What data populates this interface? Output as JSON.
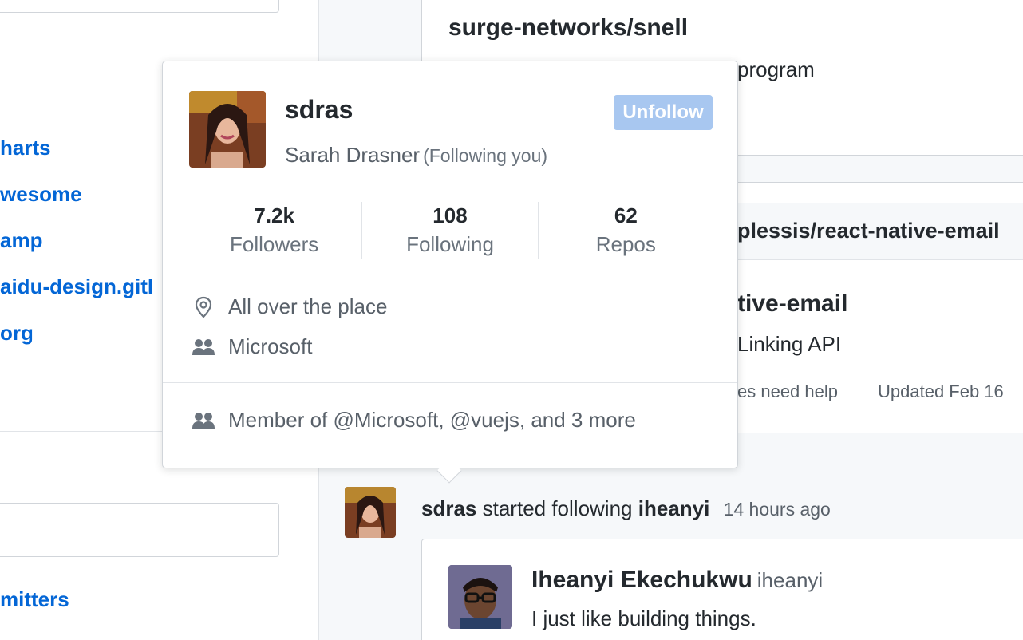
{
  "sidebar": {
    "repos": [
      "harts",
      "wesome",
      "amp",
      "aidu-design.gitl",
      "org"
    ],
    "bottom_link": "mitters"
  },
  "feed": {
    "card1": {
      "title": "surge-networks/snell",
      "desc_fragment": "program"
    },
    "card2": {
      "band_title": "plessis/react-native-email",
      "title_fragment": "tive-email",
      "desc_fragment": "Linking API",
      "meta_issues": "es need help",
      "meta_updated": "Updated Feb 16"
    },
    "event": {
      "actor": "sdras",
      "verb": "started following",
      "target": "iheanyi",
      "time": "14 hours ago"
    },
    "followed_user": {
      "name": "Iheanyi Ekechukwu",
      "login": "iheanyi",
      "bio": "I just like building things."
    }
  },
  "hovercard": {
    "login": "sdras",
    "name": "Sarah Drasner",
    "follow_note": "(Following you)",
    "button_label": "Unfollow",
    "stats": [
      {
        "value": "7.2k",
        "label": "Followers"
      },
      {
        "value": "108",
        "label": "Following"
      },
      {
        "value": "62",
        "label": "Repos"
      }
    ],
    "location": "All over the place",
    "company": "Microsoft",
    "orgs": "Member of @Microsoft, @vuejs, and 3 more",
    "icons": {
      "location": "location-pin-icon",
      "company": "people-icon",
      "orgs": "organization-icon"
    }
  },
  "colors": {
    "link": "#0366d6",
    "button_disabled": "#a8c7f0",
    "muted": "#586069",
    "border": "#d1d5da"
  }
}
